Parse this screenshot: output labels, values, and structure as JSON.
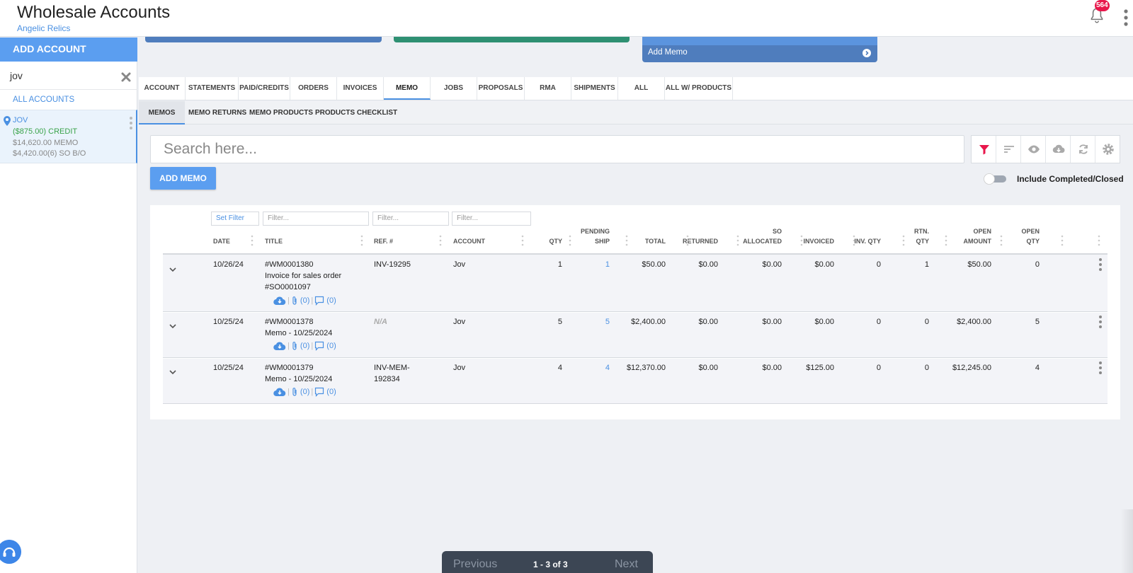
{
  "header": {
    "title": "Wholesale Accounts",
    "subtitle": "Angelic Relics",
    "notif_count": "564"
  },
  "sidebar": {
    "add_account": "ADD ACCOUNT",
    "search_value": "jov",
    "all_accounts": "ALL ACCOUNTS",
    "account": {
      "name": "JOV",
      "credit": "($875.00) CREDIT",
      "memo": "$14,620.00 MEMO",
      "so": "$4,420.00(6) SO B/O"
    }
  },
  "cards": {
    "add_memo": "Add Memo"
  },
  "tabs": [
    "ACCOUNT",
    "STATEMENTS",
    "PAID/CREDITS",
    "ORDERS",
    "INVOICES",
    "MEMO",
    "JOBS",
    "PROPOSALS",
    "RMA",
    "SHIPMENTS",
    "ALL",
    "ALL W/ PRODUCTS"
  ],
  "subtabs": [
    "MEMOS",
    "MEMO RETURNS",
    "MEMO PRODUCTS",
    "PRODUCTS CHECKLIST"
  ],
  "toolbar": {
    "search_placeholder": "Search here...",
    "add_memo": "ADD MEMO",
    "include_closed": "Include Completed/Closed"
  },
  "filters": {
    "set_filter": "Set Filter",
    "placeholder": "Filter..."
  },
  "columns": {
    "date": "DATE",
    "title": "TITLE",
    "ref": "REF. #",
    "account": "ACCOUNT",
    "qty": "QTY",
    "pending_1": "PENDING",
    "pending_2": "SHIP",
    "total": "TOTAL",
    "returned": "RETURNED",
    "so_1": "SO",
    "so_2": "ALLOCATED",
    "invoiced": "INVOICED",
    "inv_qty": "INV. QTY",
    "rtn_1": "RTN.",
    "rtn_2": "QTY",
    "open_amt_1": "OPEN",
    "open_amt_2": "AMOUNT",
    "open_qty_1": "OPEN",
    "open_qty_2": "QTY"
  },
  "rows": [
    {
      "date": "10/26/24",
      "title_1": "#WM0001380",
      "title_2": "Invoice for sales order",
      "title_3": "#SO0001097",
      "ref_1": "INV-19295",
      "ref_2": "",
      "account": "Jov",
      "qty": "1",
      "pending": "1",
      "total": "$50.00",
      "returned": "$0.00",
      "so": "$0.00",
      "invoiced": "$0.00",
      "inv_qty": "0",
      "rtn_qty": "1",
      "open_amount": "$50.00",
      "open_qty": "0",
      "files": "(0)",
      "comments": "(0)"
    },
    {
      "date": "10/25/24",
      "title_1": "#WM0001378",
      "title_2": "Memo - 10/25/2024",
      "title_3": "",
      "ref_1": "N/A",
      "ref_2": "",
      "account": "Jov",
      "qty": "5",
      "pending": "5",
      "total": "$2,400.00",
      "returned": "$0.00",
      "so": "$0.00",
      "invoiced": "$0.00",
      "inv_qty": "0",
      "rtn_qty": "0",
      "open_amount": "$2,400.00",
      "open_qty": "5",
      "files": "(0)",
      "comments": "(0)"
    },
    {
      "date": "10/25/24",
      "title_1": "#WM0001379",
      "title_2": "Memo - 10/25/2024",
      "title_3": "",
      "ref_1": "INV-MEM-",
      "ref_2": "192834",
      "account": "Jov",
      "qty": "4",
      "pending": "4",
      "total": "$12,370.00",
      "returned": "$0.00",
      "so": "$0.00",
      "invoiced": "$125.00",
      "inv_qty": "0",
      "rtn_qty": "0",
      "open_amount": "$12,245.00",
      "open_qty": "4",
      "files": "(0)",
      "comments": "(0)"
    }
  ],
  "pager": {
    "previous": "Previous",
    "info": "1 - 3 of 3",
    "next": "Next"
  },
  "colors": {
    "accent": "#4a90e2",
    "credit": "#3aa34a",
    "badge": "#e8174b",
    "filter_active": "#e8174b"
  }
}
